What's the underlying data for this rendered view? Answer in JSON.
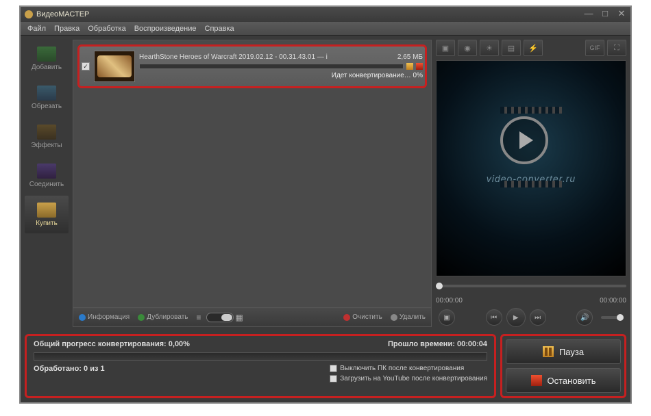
{
  "window": {
    "title": "ВидеоМАСТЕР"
  },
  "menu": {
    "file": "Файл",
    "edit": "Правка",
    "process": "Обработка",
    "playback": "Воспроизведение",
    "help": "Справка"
  },
  "sidebar": {
    "add": "Добавить",
    "cut": "Обрезать",
    "fx": "Эффекты",
    "join": "Соединить",
    "buy": "Купить"
  },
  "item": {
    "filename": "HearthStone  Heroes of Warcraft 2019.02.12 - 00.31.43.01 — і",
    "size": "2,65 МБ",
    "status": "Идет конвертирование… 0%"
  },
  "centerbar": {
    "info": "Информация",
    "dup": "Дублировать",
    "clear": "Очистить",
    "del": "Удалить"
  },
  "preview": {
    "brand": "video-converter.ru",
    "time_start": "00:00:00",
    "time_end": "00:00:00",
    "ptool": {
      "gif": "GIF"
    }
  },
  "progress": {
    "label": "Общий прогресс конвертирования:",
    "value": "0,00%",
    "elapsed_label": "Прошло времени:",
    "elapsed": "00:00:04",
    "done_label": "Обработано:",
    "done": "0 из 1",
    "opt_shutdown": "Выключить ПК после конвертирования",
    "opt_youtube": "Загрузить на YouTube после конвертирования"
  },
  "actions": {
    "pause": "Пауза",
    "stop": "Остановить"
  }
}
